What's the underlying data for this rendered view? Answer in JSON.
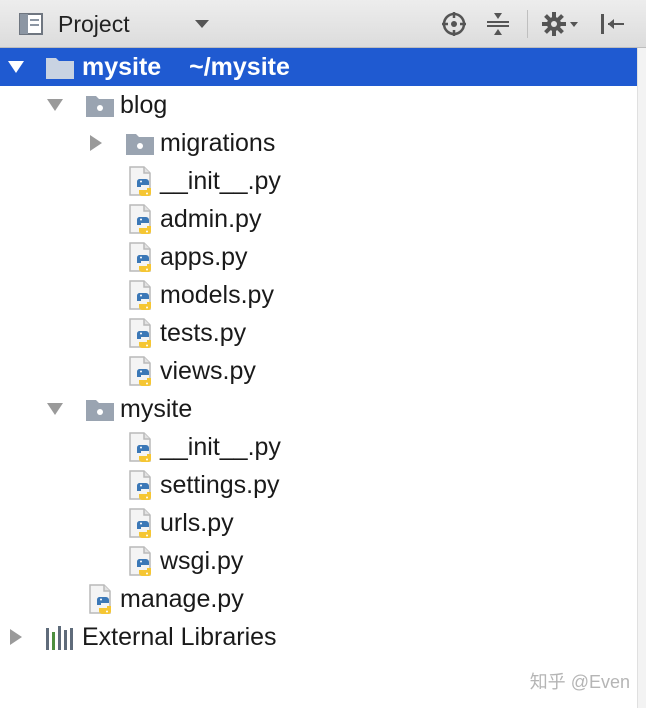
{
  "toolbar": {
    "title": "Project",
    "icons": [
      "project-view-icon",
      "dropdown-caret-icon",
      "locate-target-icon",
      "collapse-all-icon",
      "gear-icon",
      "hide-panel-icon"
    ]
  },
  "tree": {
    "root": {
      "name": "mysite",
      "path": "~/mysite"
    },
    "blog": {
      "name": "blog",
      "migrations": "migrations",
      "files": [
        "__init__.py",
        "admin.py",
        "apps.py",
        "models.py",
        "tests.py",
        "views.py"
      ]
    },
    "mysite_pkg": {
      "name": "mysite",
      "files": [
        "__init__.py",
        "settings.py",
        "urls.py",
        "wsgi.py"
      ]
    },
    "manage": "manage.py",
    "external": "External Libraries"
  },
  "colors": {
    "selection": "#1f5ad1",
    "toolbar": "#e3e3e3",
    "folder": "#9aa4b1"
  },
  "watermark": "知乎 @Even"
}
